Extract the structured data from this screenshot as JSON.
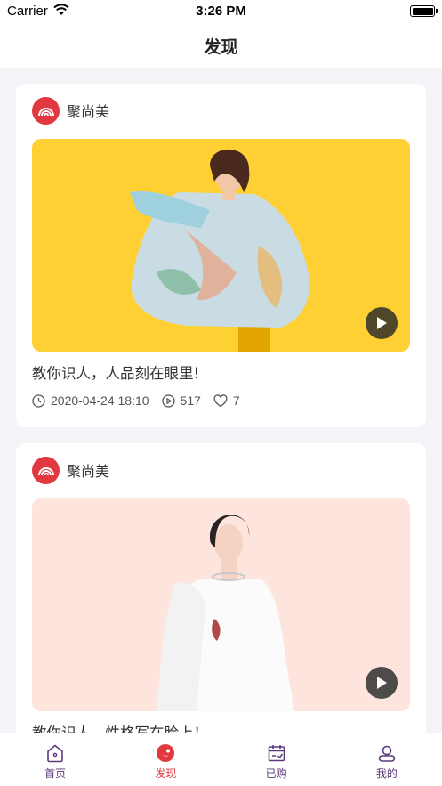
{
  "status_bar": {
    "carrier": "Carrier",
    "time": "3:26 PM"
  },
  "header": {
    "title": "发现"
  },
  "feed": {
    "items": [
      {
        "author": "聚尚美",
        "title": "教你识人，人品刻在眼里!",
        "date": "2020-04-24 18:10",
        "plays": "517",
        "likes": "7",
        "thumb_color": "#ffd033"
      },
      {
        "author": "聚尚美",
        "title": "教你识人，性格写在脸上！",
        "thumb_color": "#fde5de"
      }
    ]
  },
  "tabs": [
    {
      "label": "首页",
      "icon": "home-icon",
      "active": false
    },
    {
      "label": "发现",
      "icon": "discover-icon",
      "active": true
    },
    {
      "label": "已购",
      "icon": "purchased-icon",
      "active": false
    },
    {
      "label": "我的",
      "icon": "profile-icon",
      "active": false
    }
  ],
  "colors": {
    "accent": "#e2383f",
    "tab_inactive": "#5a3a7a"
  }
}
